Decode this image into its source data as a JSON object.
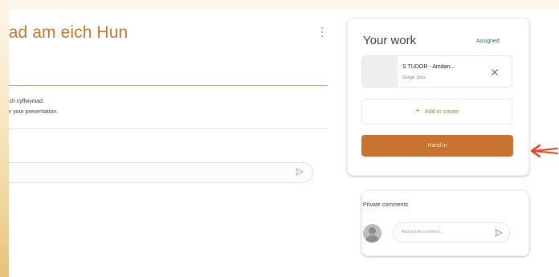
{
  "assignment": {
    "title": "iad am eich Hun",
    "instructions": [
      "aich cyflwyniad.",
      "for your presentation."
    ],
    "class_comment_placeholder": ""
  },
  "your_work": {
    "title": "Your work",
    "status": "Assigned",
    "attachment": {
      "name": "S TUDOR - Amdan...",
      "type": "Google Docs"
    },
    "add_create_label": "Add or create",
    "hand_in_label": "Hand in"
  },
  "private_comments": {
    "title": "Private comments",
    "placeholder": "Add private comment..."
  },
  "colors": {
    "accent": "#c8732f",
    "title": "#c5762a",
    "status_green": "#188038",
    "annotation_arrow": "#e8401c"
  },
  "icons": {
    "more": "more-vert-icon",
    "remove": "close-icon",
    "add": "plus-icon",
    "send": "send-icon",
    "avatar": "account-avatar-icon",
    "annotation": "red-arrow-annotation"
  }
}
